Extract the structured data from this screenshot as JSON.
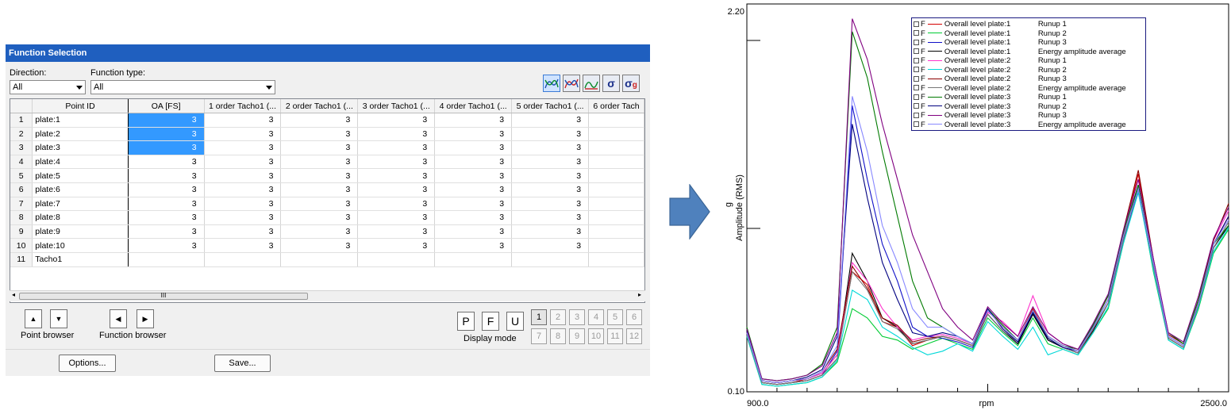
{
  "panel": {
    "title": "Function Selection",
    "direction_label": "Direction:",
    "direction_value": "All",
    "function_type_label": "Function type:",
    "function_type_value": "All",
    "toolbar_icons": [
      "curve-overlay-icon",
      "curve-compare-icon",
      "curve-average-icon",
      "sigma-icon",
      "sigma-g-icon"
    ],
    "columns": [
      "Point ID",
      "OA [FS]",
      "1 order Tacho1 (...",
      "2 order Tacho1 (...",
      "3 order Tacho1 (...",
      "4 order Tacho1 (...",
      "5 order Tacho1 (...",
      "6 order Tach"
    ],
    "rows": [
      {
        "n": "1",
        "id": "plate:1",
        "v": [
          "3",
          "3",
          "3",
          "3",
          "3",
          "3"
        ]
      },
      {
        "n": "2",
        "id": "plate:2",
        "v": [
          "3",
          "3",
          "3",
          "3",
          "3",
          "3"
        ]
      },
      {
        "n": "3",
        "id": "plate:3",
        "v": [
          "3",
          "3",
          "3",
          "3",
          "3",
          "3"
        ]
      },
      {
        "n": "4",
        "id": "plate:4",
        "v": [
          "3",
          "3",
          "3",
          "3",
          "3",
          "3"
        ]
      },
      {
        "n": "5",
        "id": "plate:5",
        "v": [
          "3",
          "3",
          "3",
          "3",
          "3",
          "3"
        ]
      },
      {
        "n": "6",
        "id": "plate:6",
        "v": [
          "3",
          "3",
          "3",
          "3",
          "3",
          "3"
        ]
      },
      {
        "n": "7",
        "id": "plate:7",
        "v": [
          "3",
          "3",
          "3",
          "3",
          "3",
          "3"
        ]
      },
      {
        "n": "8",
        "id": "plate:8",
        "v": [
          "3",
          "3",
          "3",
          "3",
          "3",
          "3"
        ]
      },
      {
        "n": "9",
        "id": "plate:9",
        "v": [
          "3",
          "3",
          "3",
          "3",
          "3",
          "3"
        ]
      },
      {
        "n": "10",
        "id": "plate:10",
        "v": [
          "3",
          "3",
          "3",
          "3",
          "3",
          "3"
        ]
      },
      {
        "n": "11",
        "id": "Tacho1",
        "v": [
          "",
          "",
          "",
          "",
          "",
          ""
        ]
      }
    ],
    "selected_rows": [
      0,
      1,
      2
    ],
    "scroll_thumb_label": "III",
    "point_browser_label": "Point browser",
    "function_browser_label": "Function browser",
    "display_modes": [
      "P",
      "F",
      "U"
    ],
    "display_mode_label": "Display mode",
    "page_numbers": [
      "1",
      "2",
      "3",
      "4",
      "5",
      "6",
      "7",
      "8",
      "9",
      "10",
      "11",
      "12"
    ],
    "options_label": "Options...",
    "save_label": "Save..."
  },
  "chart_data": {
    "type": "line",
    "y_top_label": "2.20",
    "y_bottom_label": "0.10",
    "ylabel_unit": "g",
    "ylabel": "Amplitude (RMS)",
    "x_left_label": "900.0",
    "x_right_label": "2500.0",
    "xlabel": "rpm",
    "ylim": [
      0.1,
      2.2
    ],
    "xlim": [
      900,
      2500
    ],
    "x": [
      900,
      950,
      1000,
      1050,
      1100,
      1150,
      1200,
      1250,
      1300,
      1350,
      1400,
      1450,
      1500,
      1550,
      1600,
      1650,
      1700,
      1750,
      1800,
      1850,
      1900,
      1950,
      2000,
      2050,
      2100,
      2150,
      2200,
      2250,
      2300,
      2350,
      2400,
      2450,
      2500
    ],
    "legend": [
      {
        "flag": "F",
        "name": "Overall level plate:1",
        "run": "Runup 1",
        "color": "#d40000"
      },
      {
        "flag": "F",
        "name": "Overall level plate:1",
        "run": "Runup 2",
        "color": "#00cc33"
      },
      {
        "flag": "F",
        "name": "Overall level plate:1",
        "run": "Runup 3",
        "color": "#1010c8"
      },
      {
        "flag": "F",
        "name": "Overall level plate:1",
        "run": "Energy amplitude average",
        "color": "#000000"
      },
      {
        "flag": "F",
        "name": "Overall level plate:2",
        "run": "Runup 1",
        "color": "#ff33cc"
      },
      {
        "flag": "F",
        "name": "Overall level plate:2",
        "run": "Runup 2",
        "color": "#00d8d8"
      },
      {
        "flag": "F",
        "name": "Overall level plate:2",
        "run": "Runup 3",
        "color": "#8b0000"
      },
      {
        "flag": "F",
        "name": "Overall level plate:2",
        "run": "Energy amplitude average",
        "color": "#777777"
      },
      {
        "flag": "F",
        "name": "Overall level plate:3",
        "run": "Runup 1",
        "color": "#007a00"
      },
      {
        "flag": "F",
        "name": "Overall level plate:3",
        "run": "Runup 2",
        "color": "#000080"
      },
      {
        "flag": "F",
        "name": "Overall level plate:3",
        "run": "Runup 3",
        "color": "#800080"
      },
      {
        "flag": "F",
        "name": "Overall level plate:3",
        "run": "Energy amplitude average",
        "color": "#8888ff"
      }
    ],
    "series": [
      {
        "color": "#d40000",
        "values": [
          0.42,
          0.15,
          0.14,
          0.15,
          0.17,
          0.2,
          0.3,
          0.75,
          0.68,
          0.48,
          0.45,
          0.35,
          0.38,
          0.4,
          0.38,
          0.35,
          0.55,
          0.45,
          0.38,
          0.55,
          0.4,
          0.35,
          0.32,
          0.45,
          0.6,
          0.95,
          1.28,
          0.8,
          0.4,
          0.35,
          0.6,
          0.9,
          1.05
        ]
      },
      {
        "color": "#00cc33",
        "values": [
          0.4,
          0.14,
          0.13,
          0.14,
          0.15,
          0.18,
          0.26,
          0.55,
          0.5,
          0.4,
          0.38,
          0.33,
          0.36,
          0.39,
          0.36,
          0.33,
          0.5,
          0.42,
          0.35,
          0.5,
          0.36,
          0.33,
          0.3,
          0.42,
          0.55,
          0.9,
          1.2,
          0.75,
          0.38,
          0.33,
          0.55,
          0.85,
          0.98
        ]
      },
      {
        "color": "#1010c8",
        "values": [
          0.41,
          0.15,
          0.14,
          0.15,
          0.16,
          0.19,
          0.32,
          1.65,
          1.25,
          0.9,
          0.7,
          0.45,
          0.4,
          0.39,
          0.37,
          0.34,
          0.52,
          0.43,
          0.36,
          0.52,
          0.38,
          0.34,
          0.31,
          0.44,
          0.58,
          0.92,
          1.18,
          0.78,
          0.39,
          0.34,
          0.58,
          0.88,
          1.0
        ]
      },
      {
        "color": "#000000",
        "values": [
          0.41,
          0.15,
          0.14,
          0.15,
          0.16,
          0.19,
          0.28,
          0.85,
          0.7,
          0.5,
          0.45,
          0.36,
          0.38,
          0.4,
          0.38,
          0.35,
          0.52,
          0.43,
          0.36,
          0.52,
          0.38,
          0.34,
          0.31,
          0.43,
          0.58,
          0.92,
          1.22,
          0.78,
          0.39,
          0.34,
          0.57,
          0.88,
          1.0
        ]
      },
      {
        "color": "#ff33cc",
        "values": [
          0.42,
          0.16,
          0.15,
          0.16,
          0.17,
          0.2,
          0.3,
          0.8,
          0.7,
          0.55,
          0.45,
          0.38,
          0.4,
          0.41,
          0.39,
          0.36,
          0.53,
          0.48,
          0.4,
          0.62,
          0.42,
          0.36,
          0.33,
          0.46,
          0.62,
          0.96,
          1.25,
          0.82,
          0.41,
          0.36,
          0.6,
          0.92,
          1.08
        ]
      },
      {
        "color": "#00d8d8",
        "values": [
          0.4,
          0.14,
          0.13,
          0.14,
          0.15,
          0.18,
          0.27,
          0.65,
          0.6,
          0.45,
          0.4,
          0.34,
          0.3,
          0.32,
          0.36,
          0.32,
          0.48,
          0.4,
          0.33,
          0.45,
          0.3,
          0.33,
          0.3,
          0.42,
          0.56,
          0.9,
          1.18,
          0.76,
          0.38,
          0.33,
          0.56,
          0.86,
          0.99
        ]
      },
      {
        "color": "#8b0000",
        "values": [
          0.43,
          0.16,
          0.15,
          0.16,
          0.17,
          0.21,
          0.33,
          0.78,
          0.66,
          0.5,
          0.46,
          0.37,
          0.39,
          0.4,
          0.38,
          0.35,
          0.54,
          0.45,
          0.38,
          0.54,
          0.4,
          0.35,
          0.32,
          0.46,
          0.62,
          0.97,
          1.3,
          0.82,
          0.41,
          0.36,
          0.6,
          0.92,
          1.12
        ]
      },
      {
        "color": "#777777",
        "values": [
          0.41,
          0.15,
          0.14,
          0.15,
          0.16,
          0.19,
          0.28,
          0.75,
          0.65,
          0.48,
          0.44,
          0.36,
          0.38,
          0.4,
          0.38,
          0.35,
          0.52,
          0.43,
          0.37,
          0.53,
          0.39,
          0.34,
          0.31,
          0.44,
          0.58,
          0.92,
          1.2,
          0.78,
          0.39,
          0.34,
          0.57,
          0.88,
          1.02
        ]
      },
      {
        "color": "#007a00",
        "values": [
          0.45,
          0.17,
          0.16,
          0.17,
          0.19,
          0.25,
          0.45,
          2.05,
          1.8,
          1.4,
          1.05,
          0.7,
          0.5,
          0.45,
          0.4,
          0.36,
          0.55,
          0.46,
          0.38,
          0.54,
          0.4,
          0.35,
          0.33,
          0.46,
          0.62,
          0.96,
          1.22,
          0.8,
          0.42,
          0.36,
          0.6,
          0.9,
          1.0
        ]
      },
      {
        "color": "#000080",
        "values": [
          0.43,
          0.16,
          0.15,
          0.16,
          0.18,
          0.22,
          0.4,
          1.55,
          1.15,
          0.8,
          0.6,
          0.42,
          0.4,
          0.42,
          0.4,
          0.36,
          0.55,
          0.44,
          0.37,
          0.53,
          0.39,
          0.34,
          0.32,
          0.45,
          0.6,
          0.94,
          1.2,
          0.8,
          0.4,
          0.35,
          0.58,
          0.9,
          1.05
        ]
      },
      {
        "color": "#800080",
        "values": [
          0.44,
          0.17,
          0.16,
          0.17,
          0.19,
          0.24,
          0.42,
          2.12,
          1.9,
          1.55,
          1.25,
          0.95,
          0.75,
          0.55,
          0.45,
          0.38,
          0.56,
          0.47,
          0.4,
          0.56,
          0.42,
          0.36,
          0.33,
          0.47,
          0.63,
          0.97,
          1.25,
          0.82,
          0.42,
          0.37,
          0.62,
          0.93,
          1.1
        ]
      },
      {
        "color": "#8888ff",
        "values": [
          0.42,
          0.16,
          0.15,
          0.16,
          0.17,
          0.21,
          0.35,
          1.7,
          1.4,
          1.0,
          0.8,
          0.55,
          0.45,
          0.45,
          0.4,
          0.36,
          0.54,
          0.45,
          0.38,
          0.54,
          0.4,
          0.35,
          0.32,
          0.45,
          0.6,
          0.94,
          1.2,
          0.8,
          0.4,
          0.35,
          0.58,
          0.9,
          1.03
        ]
      }
    ]
  }
}
